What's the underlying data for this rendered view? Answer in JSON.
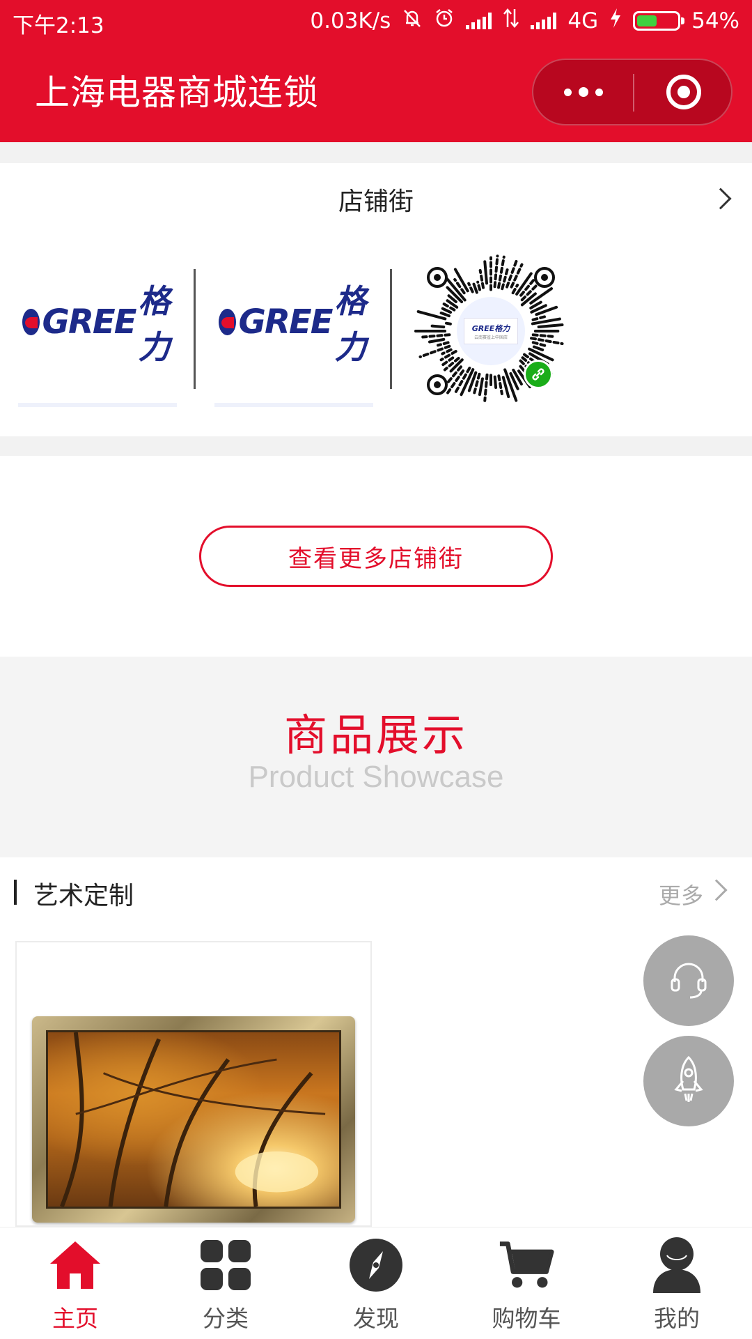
{
  "status_bar": {
    "time": "下午2:13",
    "speed": "0.03K/s",
    "network": "4G",
    "battery": "54%",
    "battery_level": 0.54
  },
  "header": {
    "title": "上海电器商城连锁",
    "capsule_icons": [
      "more-dots-icon",
      "close-target-icon"
    ]
  },
  "shop_street": {
    "title": "店铺街",
    "shops": [
      {
        "logo_text": "GREE",
        "logo_cn": "格力"
      },
      {
        "logo_text": "GREE",
        "logo_cn": "格力"
      }
    ],
    "qr_center_brand": "GREE格力",
    "qr_center_caption": "云南赛雀上中国店",
    "more_button": "查看更多店铺街"
  },
  "showcase": {
    "title": "商品展示",
    "subtitle": "Product Showcase"
  },
  "category": {
    "title": "艺术定制",
    "more": "更多"
  },
  "floating": [
    "headset-icon",
    "rocket-icon"
  ],
  "tabbar": {
    "tabs": [
      {
        "label": "主页",
        "icon": "home-icon",
        "active": true
      },
      {
        "label": "分类",
        "icon": "grid-icon",
        "active": false
      },
      {
        "label": "发现",
        "icon": "compass-icon",
        "active": false
      },
      {
        "label": "购物车",
        "icon": "cart-icon",
        "active": false
      },
      {
        "label": "我的",
        "icon": "user-icon",
        "active": false
      }
    ]
  },
  "colors": {
    "brand_red": "#e30e2b",
    "gree_blue": "#1d2a8a",
    "miniprogram_green": "#1aad19"
  }
}
